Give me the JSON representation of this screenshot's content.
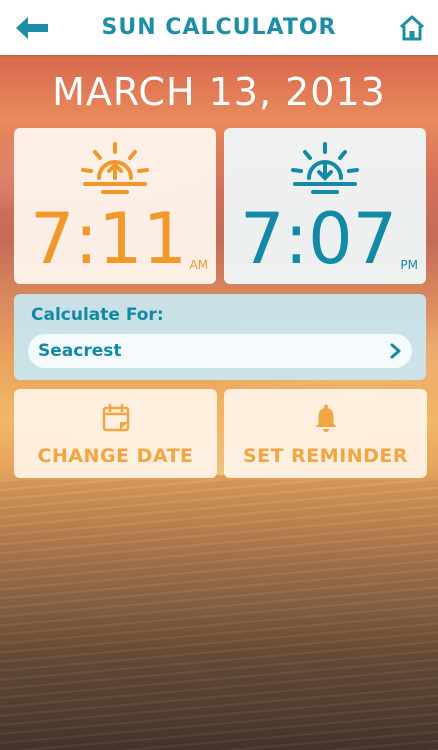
{
  "header": {
    "title": "SUN CALCULATOR",
    "back_icon": "arrow-left-icon",
    "home_icon": "home-icon"
  },
  "date": "MARCH 13, 2013",
  "sunrise": {
    "icon": "sunrise-icon",
    "time": "7:11",
    "meridiem": "AM",
    "color": "#f2982b"
  },
  "sunset": {
    "icon": "sunset-icon",
    "time": "7:07",
    "meridiem": "PM",
    "color": "#1389a8"
  },
  "calculate": {
    "label": "Calculate For:",
    "location": "Seacrest",
    "chevron_icon": "chevron-right-icon"
  },
  "actions": {
    "change_date": {
      "label": "CHANGE DATE",
      "icon": "calendar-icon"
    },
    "set_reminder": {
      "label": "SET REMINDER",
      "icon": "bell-icon"
    }
  },
  "colors": {
    "accent_teal": "#1d8ea6",
    "accent_orange": "#f2a543"
  }
}
